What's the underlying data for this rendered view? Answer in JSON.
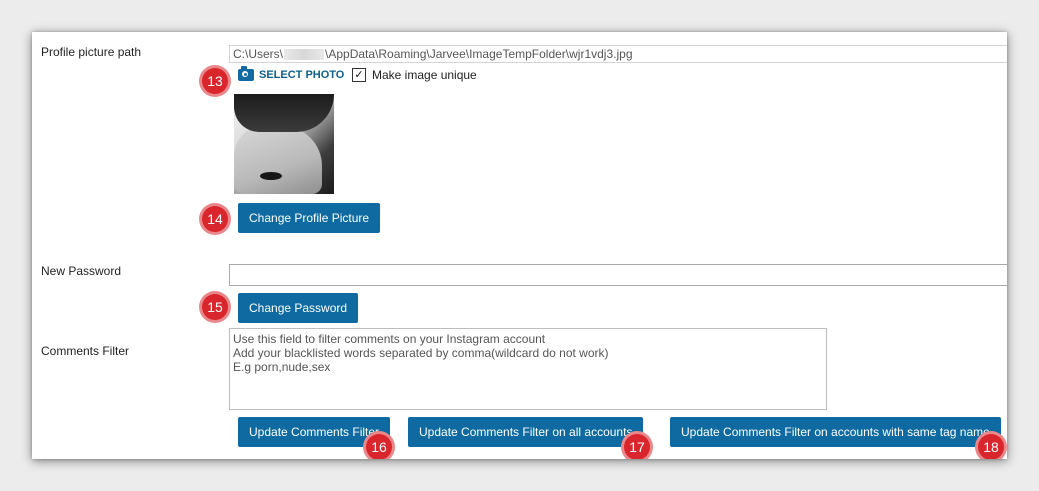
{
  "profile": {
    "picture_label": "Profile picture path",
    "path_prefix": "C:\\Users\\",
    "path_suffix": "\\AppData\\Roaming\\Jarvee\\ImageTempFolder\\wjr1vdj3.jpg",
    "select_photo_label": "SELECT PHOTO",
    "make_unique_label": "Make image unique",
    "make_unique_checked": "✓",
    "change_picture_button": "Change Profile Picture"
  },
  "password": {
    "label": "New Password",
    "value": "",
    "change_button": "Change Password"
  },
  "comments": {
    "label": "Comments Filter",
    "placeholder_lines": [
      "Use this field to filter comments on your Instagram account",
      "Add your blacklisted words separated by comma(wildcard do not work)",
      "E.g porn,nude,sex"
    ],
    "update_button": "Update Comments Filter",
    "update_all_button": "Update Comments Filter on all accounts",
    "update_tag_button": "Update Comments Filter on accounts with same tag name"
  },
  "badges": [
    "13",
    "14",
    "15",
    "16",
    "17",
    "18"
  ],
  "colors": {
    "button": "#0e6aa0",
    "badge": "#d9262c",
    "link": "#0c5f8a"
  }
}
